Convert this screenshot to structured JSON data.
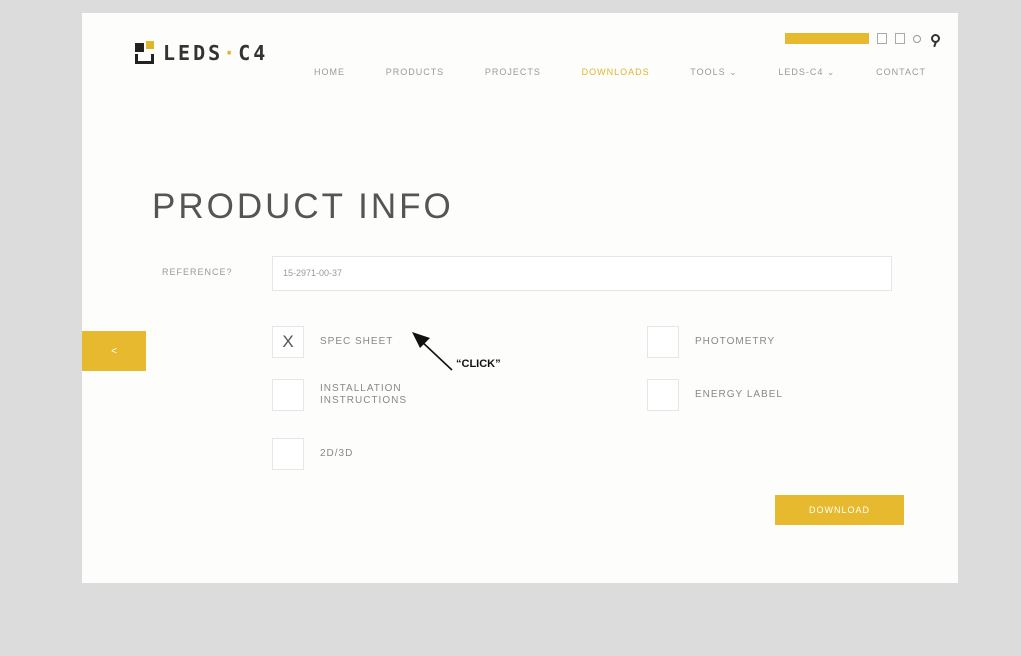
{
  "logo": {
    "text_a": "LEDS",
    "dot": "·",
    "text_b": "C4"
  },
  "topbar": {
    "yellow_label": "",
    "btn1_label": "",
    "btn2_label": "",
    "lang_label": ""
  },
  "nav": {
    "items": [
      "HOME",
      "PRODUCTS",
      "PROJECTS",
      "DOWNLOADS",
      "TOOLS ⌄",
      "LEDS-C4 ⌄",
      "CONTACT"
    ]
  },
  "page_title": "PRODUCT INFO",
  "reference": {
    "label": "REFERENCE?",
    "value": "15-2971-00-37"
  },
  "options": [
    {
      "label": "SPEC SHEET",
      "checked": "X"
    },
    {
      "label": "PHOTOMETRY",
      "checked": ""
    },
    {
      "label_line1": "INSTALLATION",
      "label_line2": "INSTRUCTIONS",
      "checked": ""
    },
    {
      "label": "ENERGY LABEL",
      "checked": ""
    },
    {
      "label": "2D/3D",
      "checked": ""
    }
  ],
  "share_icon": "<",
  "download_label": "DOWNLOAD",
  "annotation": {
    "text": "“CLICK”"
  },
  "colors": {
    "accent": "#e6b92e",
    "background": "#dcdcdc",
    "page": "#fdfdfc"
  }
}
